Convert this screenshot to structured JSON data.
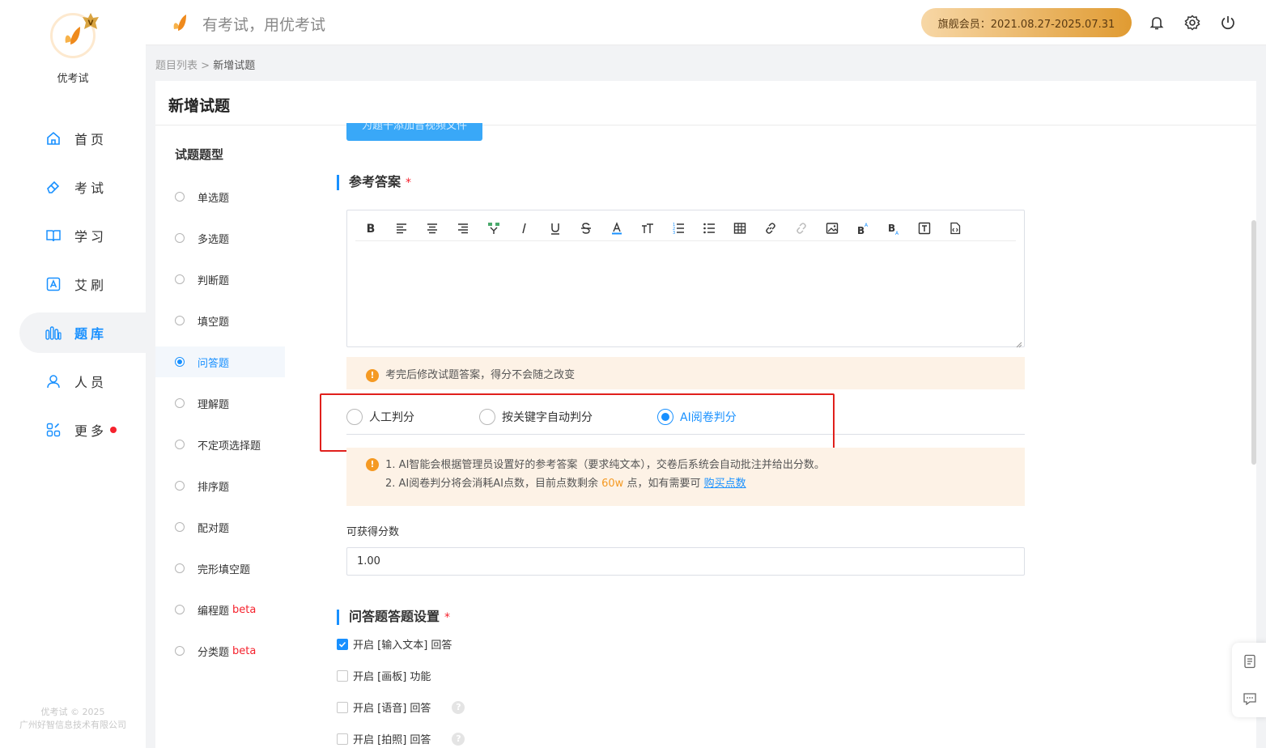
{
  "brand": {
    "name": "优考试",
    "slogan": "有考试，用优考试",
    "copyright_line1": "优考试 © 2025",
    "copyright_line2": "广州好智信息技术有限公司"
  },
  "header": {
    "vip_text": "旗舰会员：2021.08.27-2025.07.31"
  },
  "nav": [
    {
      "label": "首页",
      "icon": "home-icon"
    },
    {
      "label": "考试",
      "icon": "eraser-icon"
    },
    {
      "label": "学习",
      "icon": "book-icon"
    },
    {
      "label": "艾刷",
      "icon": "a-box-icon"
    },
    {
      "label": "题库",
      "icon": "bars-icon",
      "active": true
    },
    {
      "label": "人员",
      "icon": "user-icon"
    },
    {
      "label": "更多",
      "icon": "apps-icon",
      "badge": true
    }
  ],
  "breadcrumb": {
    "parent": "题目列表",
    "sep": " > ",
    "current": "新增试题"
  },
  "page": {
    "title": "新增试题",
    "type_heading": "试题题型"
  },
  "question_types": [
    {
      "label": "单选题"
    },
    {
      "label": "多选题"
    },
    {
      "label": "判断题"
    },
    {
      "label": "填空题"
    },
    {
      "label": "问答题",
      "selected": true
    },
    {
      "label": "理解题"
    },
    {
      "label": "不定项选择题"
    },
    {
      "label": "排序题"
    },
    {
      "label": "配对题"
    },
    {
      "label": "完形填空题"
    },
    {
      "label": "编程题",
      "beta": "beta"
    },
    {
      "label": "分类题",
      "beta": "beta"
    }
  ],
  "upload_button": "为题干添加音视频文件",
  "answer": {
    "title": "参考答案",
    "required_mark": "*",
    "toolbar_icons": [
      "bold-icon",
      "align-left-icon",
      "align-center-icon",
      "align-right-icon",
      "format-painter-icon",
      "italic-icon",
      "underline-icon",
      "strikethrough-icon",
      "font-color-icon",
      "font-size-icon",
      "ordered-list-icon",
      "unordered-list-icon",
      "table-icon",
      "link-icon",
      "unlink-icon",
      "image-icon",
      "superscript-icon",
      "subscript-icon",
      "text-box-icon",
      "html-file-icon"
    ],
    "notice": "考完后修改试题答案，得分不会随之改变"
  },
  "grading": {
    "options": [
      {
        "label": "人工判分"
      },
      {
        "label": "按关键字自动判分"
      },
      {
        "label": "AI阅卷判分",
        "selected": true
      }
    ],
    "note_line1": "1. AI智能会根据管理员设置好的参考答案（要求纯文本），交卷后系统会自动批注并给出分数。",
    "note_line2_prefix": "2. AI阅卷判分将会消耗AI点数，目前点数剩余",
    "points_left": "60w",
    "note_line2_suffix": "点，如有需要可",
    "buy_link": "购买点数"
  },
  "score": {
    "label": "可获得分数",
    "value": "1.00"
  },
  "answer_settings": {
    "title": "问答题答题设置",
    "required_mark": "*",
    "options": [
      {
        "label": "开启 [输入文本] 回答",
        "checked": true
      },
      {
        "label": "开启 [画板] 功能",
        "checked": false
      },
      {
        "label": "开启 [语音] 回答",
        "checked": false,
        "help": "?"
      },
      {
        "label": "开启 [拍照] 回答",
        "checked": false,
        "help": "?"
      }
    ]
  },
  "colors": {
    "accent": "#1890ff",
    "warning": "#f59a23",
    "danger": "#f5222d",
    "vip_start": "#f7d7a6",
    "vip_end": "#e09b32"
  }
}
